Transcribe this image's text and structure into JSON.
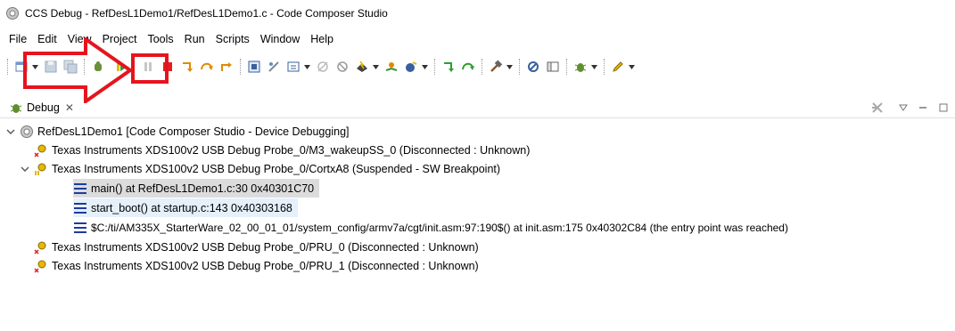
{
  "window": {
    "title": "CCS Debug - RefDesL1Demo1/RefDesL1Demo1.c - Code Composer Studio"
  },
  "menubar": {
    "items": [
      "File",
      "Edit",
      "View",
      "Project",
      "Tools",
      "Run",
      "Scripts",
      "Window",
      "Help"
    ]
  },
  "toolbar": {
    "icons": [
      "new-icon",
      "save-icon",
      "save-all-icon",
      "debug-icon",
      "resume-icon",
      "suspend-icon",
      "terminate-icon",
      "step-into-icon",
      "step-over-icon",
      "step-return-icon",
      "build-icon",
      "breakpoint-icon",
      "external-tools-icon",
      "search-icon"
    ],
    "highlighted_button": "resume-icon",
    "highlight_color": "#e5141e"
  },
  "debug_view": {
    "tab_label": "Debug",
    "tab_close": "✕",
    "tree": [
      {
        "label": "RefDesL1Demo1 [Code Composer Studio - Device Debugging]",
        "level": 0,
        "expanded": true,
        "icon": "launch-icon"
      },
      {
        "label": "Texas Instruments XDS100v2 USB Debug Probe_0/M3_wakeupSS_0 (Disconnected : Unknown)",
        "level": 1,
        "expanded": null,
        "icon": "core-disconnected-icon"
      },
      {
        "label": "Texas Instruments XDS100v2 USB Debug Probe_0/CortxA8 (Suspended - SW Breakpoint)",
        "level": 1,
        "expanded": true,
        "icon": "core-suspended-icon"
      },
      {
        "label": "main() at RefDesL1Demo1.c:30 0x40301C70",
        "level": 2,
        "expanded": null,
        "icon": "stack-frame-icon",
        "state": "selected"
      },
      {
        "label": "start_boot() at startup.c:143 0x40303168",
        "level": 2,
        "expanded": null,
        "icon": "stack-frame-icon",
        "state": "hover"
      },
      {
        "label": "$C:/ti/AM335X_StarterWare_02_00_01_01/system_config/armv7a/cgt/init.asm:97:190$() at init.asm:175 0x40302C84  (the entry point was reached)",
        "level": 2,
        "expanded": null,
        "icon": "stack-frame-icon"
      },
      {
        "label": "Texas Instruments XDS100v2 USB Debug Probe_0/PRU_0 (Disconnected : Unknown)",
        "level": 1,
        "expanded": null,
        "icon": "core-disconnected-icon"
      },
      {
        "label": "Texas Instruments XDS100v2 USB Debug Probe_0/PRU_1 (Disconnected : Unknown)",
        "level": 1,
        "expanded": null,
        "icon": "core-disconnected-icon"
      }
    ]
  }
}
